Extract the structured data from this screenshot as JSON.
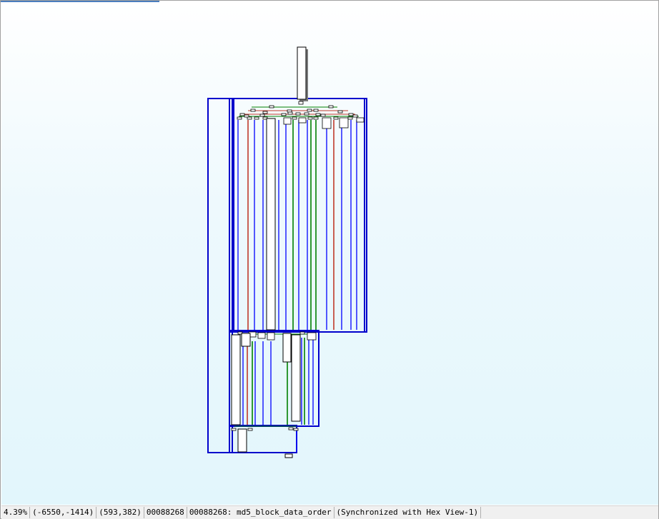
{
  "window": {
    "background_top": "#ffffff",
    "background_bottom": "#e2f6fc"
  },
  "graph": {
    "node_fill": "#ffffff",
    "node_border": "#000000",
    "node_shadow": "#7a7a7a",
    "group_border": "#0000cc",
    "edge_colors": {
      "normal": "#0000ff",
      "true": "#008000",
      "false": "#c0392b"
    }
  },
  "statusbar": {
    "zoom": "4.39%",
    "graph_coords": "(-6550,-1414)",
    "screen_coords": "(593,382)",
    "address": "00088268",
    "location": "00088268: md5_block_data_order",
    "sync": "(Synchronized with Hex View-1)"
  }
}
